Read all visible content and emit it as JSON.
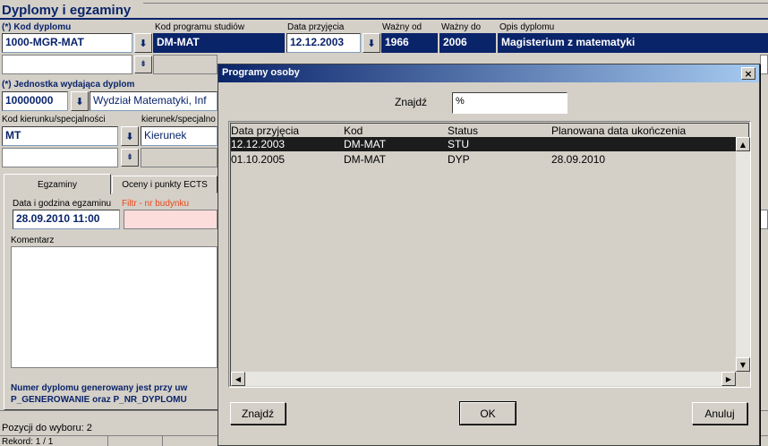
{
  "page": {
    "title": "Dyplomy i egzaminy"
  },
  "form": {
    "kod_dyplomu_label": "(*) Kod dyplomu",
    "kod_dyplomu_value": "1000-MGR-MAT",
    "kod_programu_label": "Kod programu studiów",
    "kod_programu_value": "DM-MAT",
    "data_przyjecia_label": "Data przyjęcia",
    "data_przyjecia_value": "12.12.2003",
    "wazny_od_label": "Ważny od",
    "wazny_od_value": "1966",
    "wazny_do_label": "Ważny do",
    "wazny_do_value": "2006",
    "opis_label": "Opis dyplomu",
    "opis_value": "Magisterium z matematyki",
    "jednostka_label": "(*) Jednostka wydająca dyplom",
    "jednostka_kod": "10000000",
    "jednostka_nazwa": "Wydział Matematyki, Inf",
    "kod_kierunku_label": "Kod kierunku/specjalności",
    "kod_kierunku_value": "MT",
    "kierunek_label": "kierunek/specjalno",
    "kierunek_value": "Kierunek"
  },
  "tabs": {
    "egzaminy": "Egzaminy",
    "oceny": "Oceny i punkty ECTS"
  },
  "exam": {
    "data_label": "Data i godzina egzaminu",
    "filtr_label": "Filtr - nr budynku",
    "data_value": "28.09.2010 11:00",
    "komentarz_label": "Komentarz",
    "note_line1": "Numer dyplomu generowany jest przy uw",
    "note_line2": "P_GENEROWANIE oraz P_NR_DYPLOMU"
  },
  "status_bar": {
    "pozycji": "Pozycji do wyboru: 2",
    "rekord": "Rekord: 1 / 1"
  },
  "dialog": {
    "title": "Programy osoby",
    "close_glyph": "×",
    "find_label": "Znajdź",
    "find_value": "%",
    "columns": [
      "Data przyjęcia",
      "Kod",
      "Status",
      "Planowana data ukończenia"
    ],
    "rows": [
      {
        "data": "12.12.2003",
        "kod": "DM-MAT",
        "status": "STU",
        "planowana": ""
      },
      {
        "data": "01.10.2005",
        "kod": "DM-MAT",
        "status": "DYP",
        "planowana": "28.09.2010"
      }
    ],
    "btn_find": "Znajdź",
    "btn_ok": "OK",
    "btn_cancel": "Anuluj"
  },
  "colors": {
    "accent": "#0a246a",
    "selected_row": "#1c1c1c",
    "filter_label": "#e8491d"
  },
  "icons": {
    "lov": "download-arrow-icon"
  }
}
